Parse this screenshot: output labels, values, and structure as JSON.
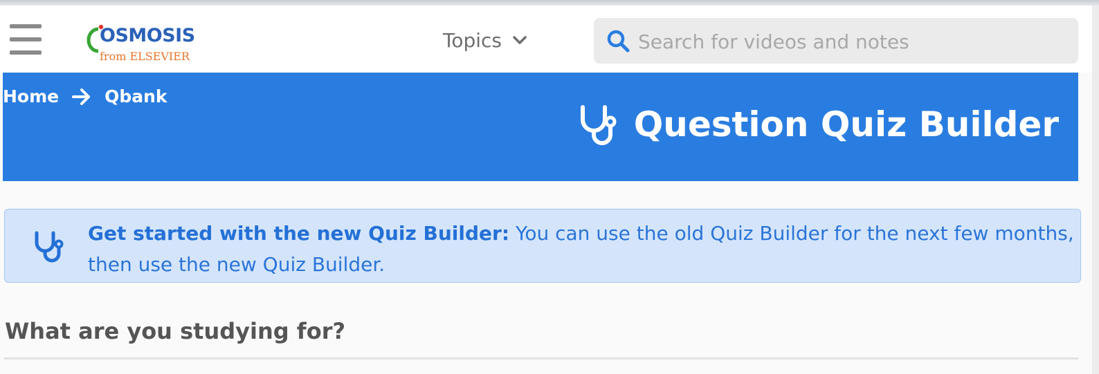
{
  "header": {
    "logo": {
      "brand": "OSMOSIS",
      "sub": "from ELSEVIER"
    },
    "topics_label": "Topics",
    "search": {
      "placeholder": "Search for videos and notes",
      "value": ""
    }
  },
  "banner": {
    "breadcrumb": [
      "Home",
      "Qbank"
    ],
    "title": "Question Quiz Builder"
  },
  "alert": {
    "strong": "Get started with the new Quiz Builder:",
    "body": " You can use the old Quiz Builder for the next few months, then use the new Quiz Builder."
  },
  "main": {
    "question": "What are you studying for?"
  },
  "colors": {
    "accent": "#2a7de0",
    "alert_bg": "#d4e5fb",
    "brand_orange": "#e8742a"
  },
  "icons": [
    "menu-icon",
    "chevron-down-icon",
    "search-icon",
    "arrow-right-icon",
    "stethoscope-icon"
  ]
}
